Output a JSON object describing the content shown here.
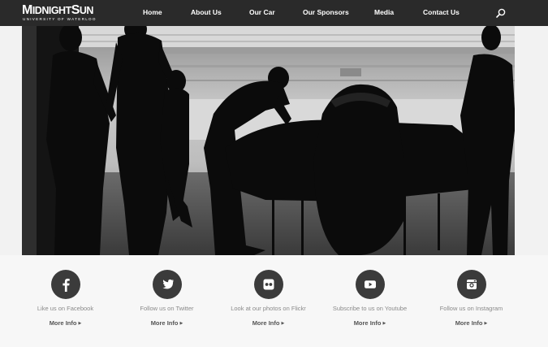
{
  "brand": {
    "logo_main_parts": [
      "M",
      "IDNIGHT",
      "S",
      "UN"
    ],
    "logo_sub": "UNIVERSITY OF WATERLOO"
  },
  "nav": {
    "items": [
      {
        "label": "Home"
      },
      {
        "label": "About Us"
      },
      {
        "label": "Our Car"
      },
      {
        "label": "Our Sponsors"
      },
      {
        "label": "Media"
      },
      {
        "label": "Contact Us"
      }
    ],
    "search_icon": "search-icon"
  },
  "hero": {
    "description": "silhouetted team working on solar car in garage"
  },
  "social": [
    {
      "icon": "facebook-icon",
      "caption": "Like us on Facebook",
      "more": "More Info"
    },
    {
      "icon": "twitter-icon",
      "caption": "Follow us on Twitter",
      "more": "More Info"
    },
    {
      "icon": "flickr-icon",
      "caption": "Look at our photos on Flickr",
      "more": "More Info"
    },
    {
      "icon": "youtube-icon",
      "caption": "Subscribe to us on Youtube",
      "more": "More Info"
    },
    {
      "icon": "instagram-icon",
      "caption": "Follow us on Instagram",
      "more": "More Info"
    }
  ],
  "colors": {
    "navbar": "#2a2a2a",
    "icon_circle": "#3b3b3b",
    "footer_bg": "#f7f7f7"
  }
}
